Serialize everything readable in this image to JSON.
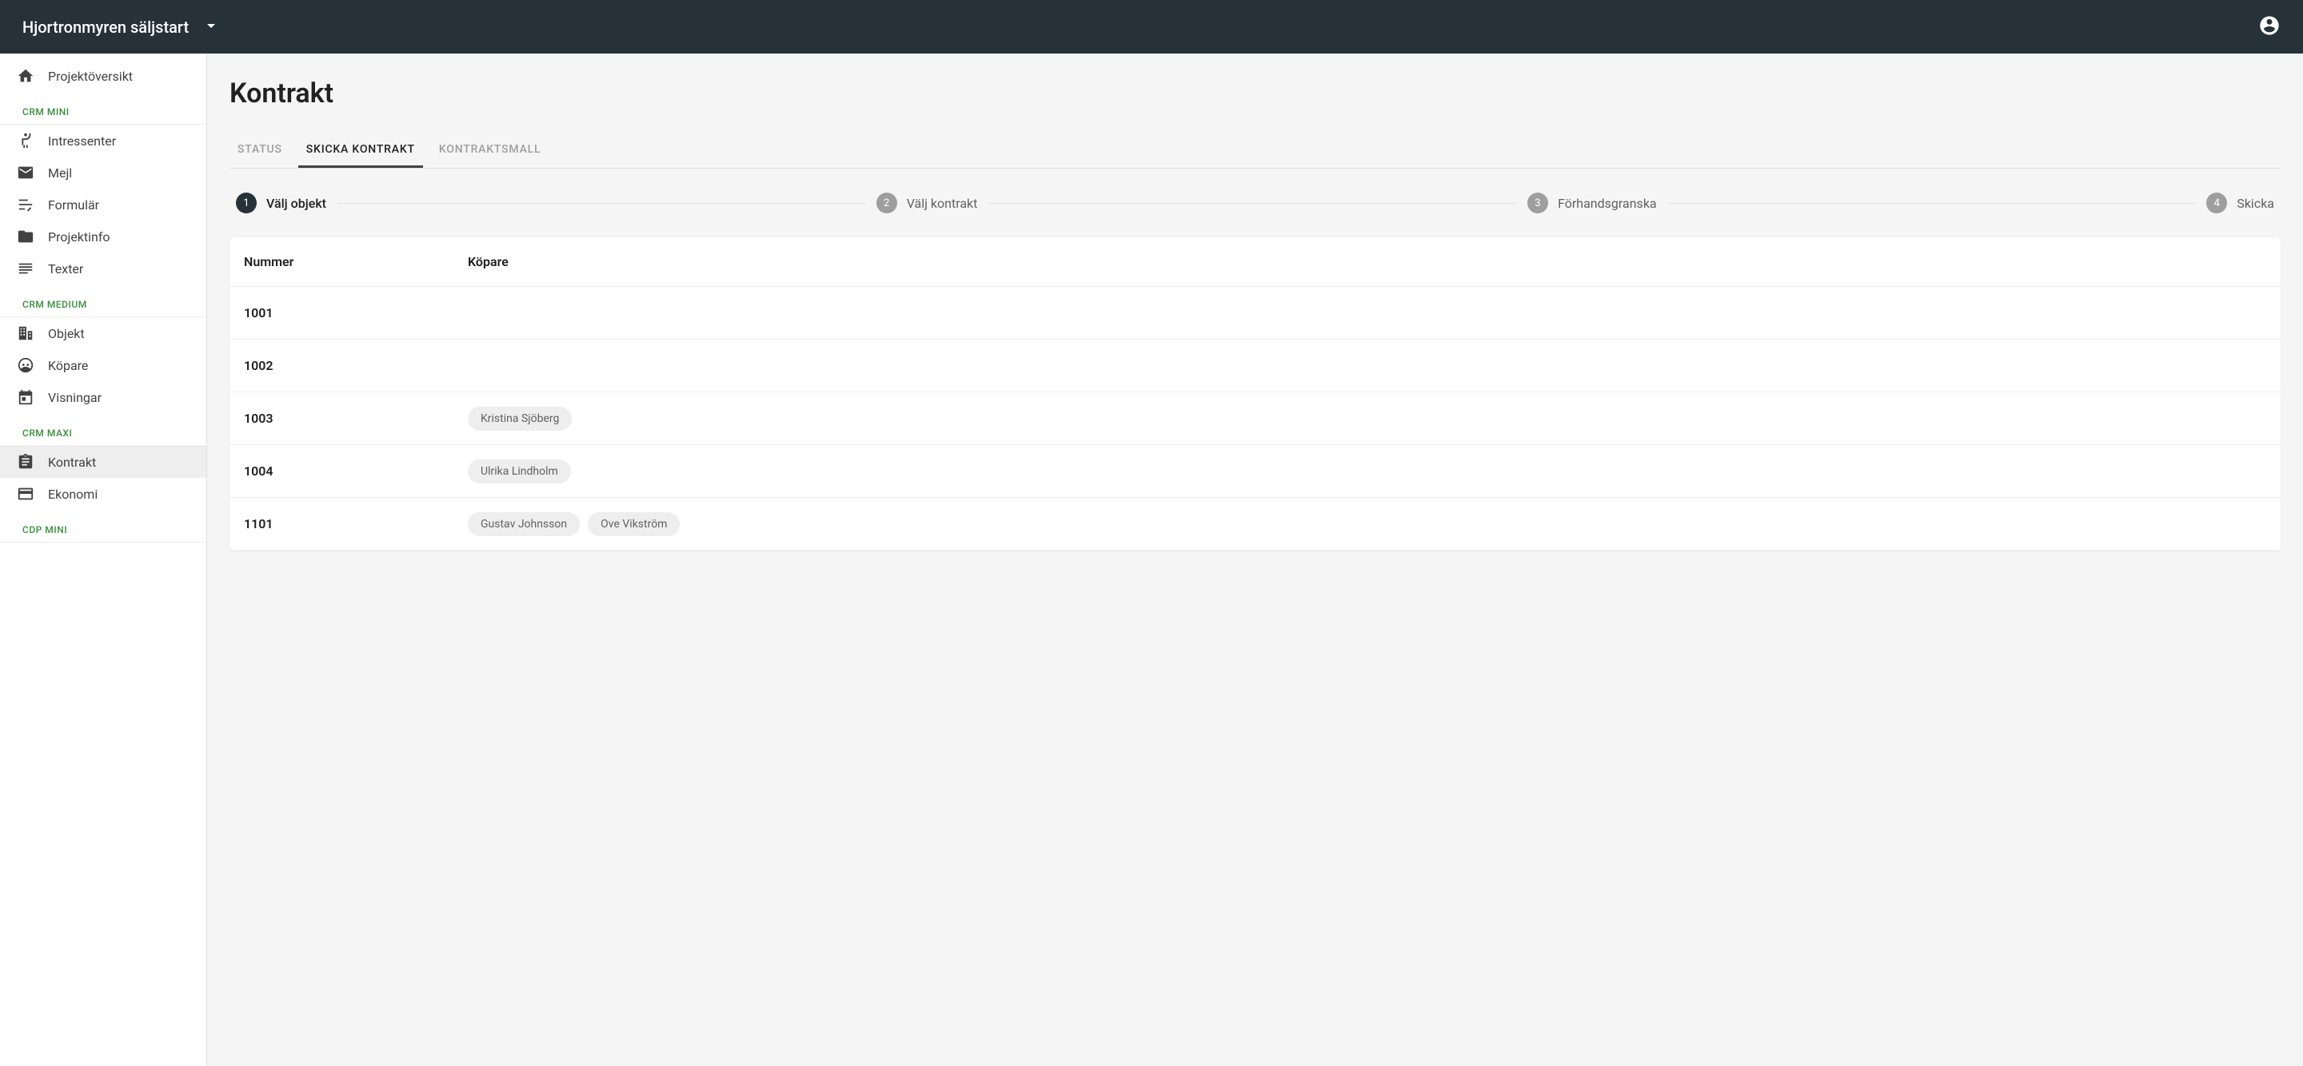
{
  "header": {
    "project_title": "Hjortronmyren säljstart"
  },
  "sidebar": {
    "top": [
      {
        "label": "Projektöversikt",
        "icon": "home"
      }
    ],
    "groups": [
      {
        "title": "CRM MINI",
        "items": [
          {
            "label": "Intressenter",
            "icon": "person-wave"
          },
          {
            "label": "Mejl",
            "icon": "mail"
          },
          {
            "label": "Formulär",
            "icon": "form"
          },
          {
            "label": "Projektinfo",
            "icon": "folder"
          },
          {
            "label": "Texter",
            "icon": "lines"
          }
        ]
      },
      {
        "title": "CRM MEDIUM",
        "items": [
          {
            "label": "Objekt",
            "icon": "building"
          },
          {
            "label": "Köpare",
            "icon": "face"
          },
          {
            "label": "Visningar",
            "icon": "calendar"
          }
        ]
      },
      {
        "title": "CRM MAXI",
        "items": [
          {
            "label": "Kontrakt",
            "icon": "clipboard",
            "active": true
          },
          {
            "label": "Ekonomi",
            "icon": "card"
          }
        ]
      },
      {
        "title": "CDP MINI",
        "items": []
      }
    ]
  },
  "page": {
    "title": "Kontrakt",
    "tabs": [
      {
        "label": "Status",
        "active": false
      },
      {
        "label": "Skicka kontrakt",
        "active": true
      },
      {
        "label": "Kontraktsmall",
        "active": false
      }
    ],
    "steps": [
      {
        "num": "1",
        "label": "Välj objekt",
        "active": true
      },
      {
        "num": "2",
        "label": "Välj kontrakt",
        "active": false
      },
      {
        "num": "3",
        "label": "Förhandsgranska",
        "active": false
      },
      {
        "num": "4",
        "label": "Skicka",
        "active": false
      }
    ],
    "table": {
      "columns": {
        "number": "Nummer",
        "buyer": "Köpare"
      },
      "rows": [
        {
          "number": "1001",
          "buyers": []
        },
        {
          "number": "1002",
          "buyers": []
        },
        {
          "number": "1003",
          "buyers": [
            "Kristina Sjöberg"
          ]
        },
        {
          "number": "1004",
          "buyers": [
            "Ulrika Lindholm"
          ]
        },
        {
          "number": "1101",
          "buyers": [
            "Gustav Johnsson",
            "Ove Vikström"
          ]
        }
      ]
    }
  }
}
